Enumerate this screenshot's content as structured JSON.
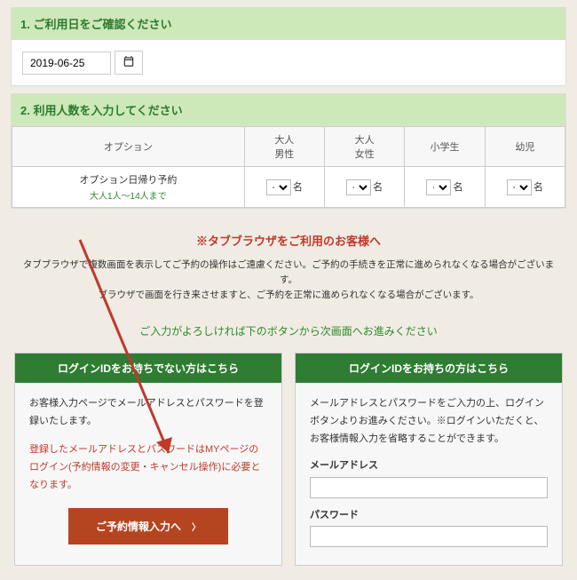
{
  "section1": {
    "title": "1. ご利用日をご確認ください",
    "date_value": "2019-06-25"
  },
  "section2": {
    "title": "2. 利用人数を入力してください",
    "col_option": "オプション",
    "col_adult_m": "大人\n男性",
    "col_adult_f": "大人\n女性",
    "col_elem": "小学生",
    "col_infant": "幼児",
    "row_name": "オプション日帰り予約",
    "row_sub": "大人1人～14人まで",
    "sel_default": "--",
    "unit": "名"
  },
  "notice": {
    "title": "※タブブラウザをご利用のお客様へ",
    "line1": "タブブラウザで複数画面を表示してご予約の操作はご遠慮ください。ご予約の手続きを正常に進められなくなる場合がございます。",
    "line2": "ブラウザで画面を行き来させますと、ご予約を正常に進められなくなる場合がございます。"
  },
  "proceed": "ご入力がよろしければ下のボタンから次画面へお進みください",
  "left_card": {
    "title": "ログインIDをお持ちでない方はこちら",
    "text1": "お客様入力ページでメールアドレスとパスワードを登録いたします。",
    "text2": "登録したメールアドレスとパスワードはMYページのログイン(予約情報の変更・キャンセル操作)に必要となります。",
    "button": "ご予約情報入力へ"
  },
  "right_card": {
    "title": "ログインIDをお持ちの方はこちら",
    "text1": "メールアドレスとパスワードをご入力の上、ログインボタンよりお進みください。※ログインいただくと、お客様情報入力を省略することができます。",
    "label_email": "メールアドレス",
    "label_password": "パスワード"
  }
}
